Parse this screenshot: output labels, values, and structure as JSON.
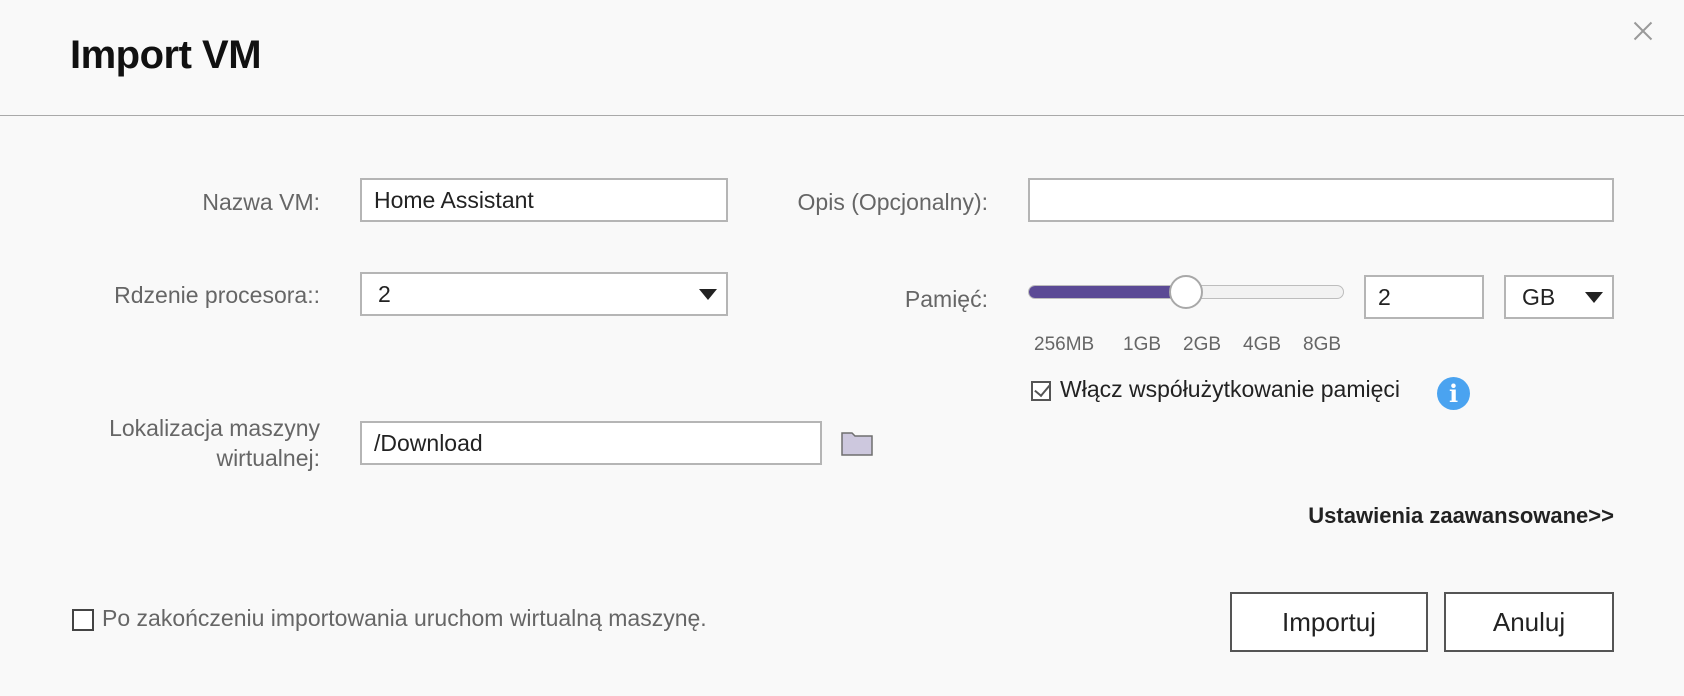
{
  "dialog": {
    "title": "Import VM"
  },
  "form": {
    "vm_name": {
      "label": "Nazwa VM:",
      "value": "Home Assistant"
    },
    "description": {
      "label": "Opis (Opcjonalny):",
      "value": ""
    },
    "cpu_cores": {
      "label": "Rdzenie procesora::",
      "selected": "2"
    },
    "memory": {
      "label": "Pamięć:",
      "value": "2",
      "unit": "GB",
      "slider_level_fraction": 0.5,
      "ticks": [
        "256MB",
        "1GB",
        "2GB",
        "4GB",
        "8GB"
      ],
      "share_label": "Włącz współużytkowanie pamięci",
      "share_checked": true
    },
    "location": {
      "label_line1": "Lokalizacja maszyny",
      "label_line2": "wirtualnej:",
      "value": "/Download"
    },
    "advanced_link": "Ustawienia zaawansowane>>",
    "start_after_import": {
      "label": "Po zakończeniu importowania uruchom wirtualną maszynę.",
      "checked": false
    }
  },
  "buttons": {
    "import": "Importuj",
    "cancel": "Anuluj"
  },
  "colors": {
    "slider_fill": "#5b4a95",
    "info_icon": "#4aa3f0",
    "folder_icon": "#cdc8de"
  }
}
